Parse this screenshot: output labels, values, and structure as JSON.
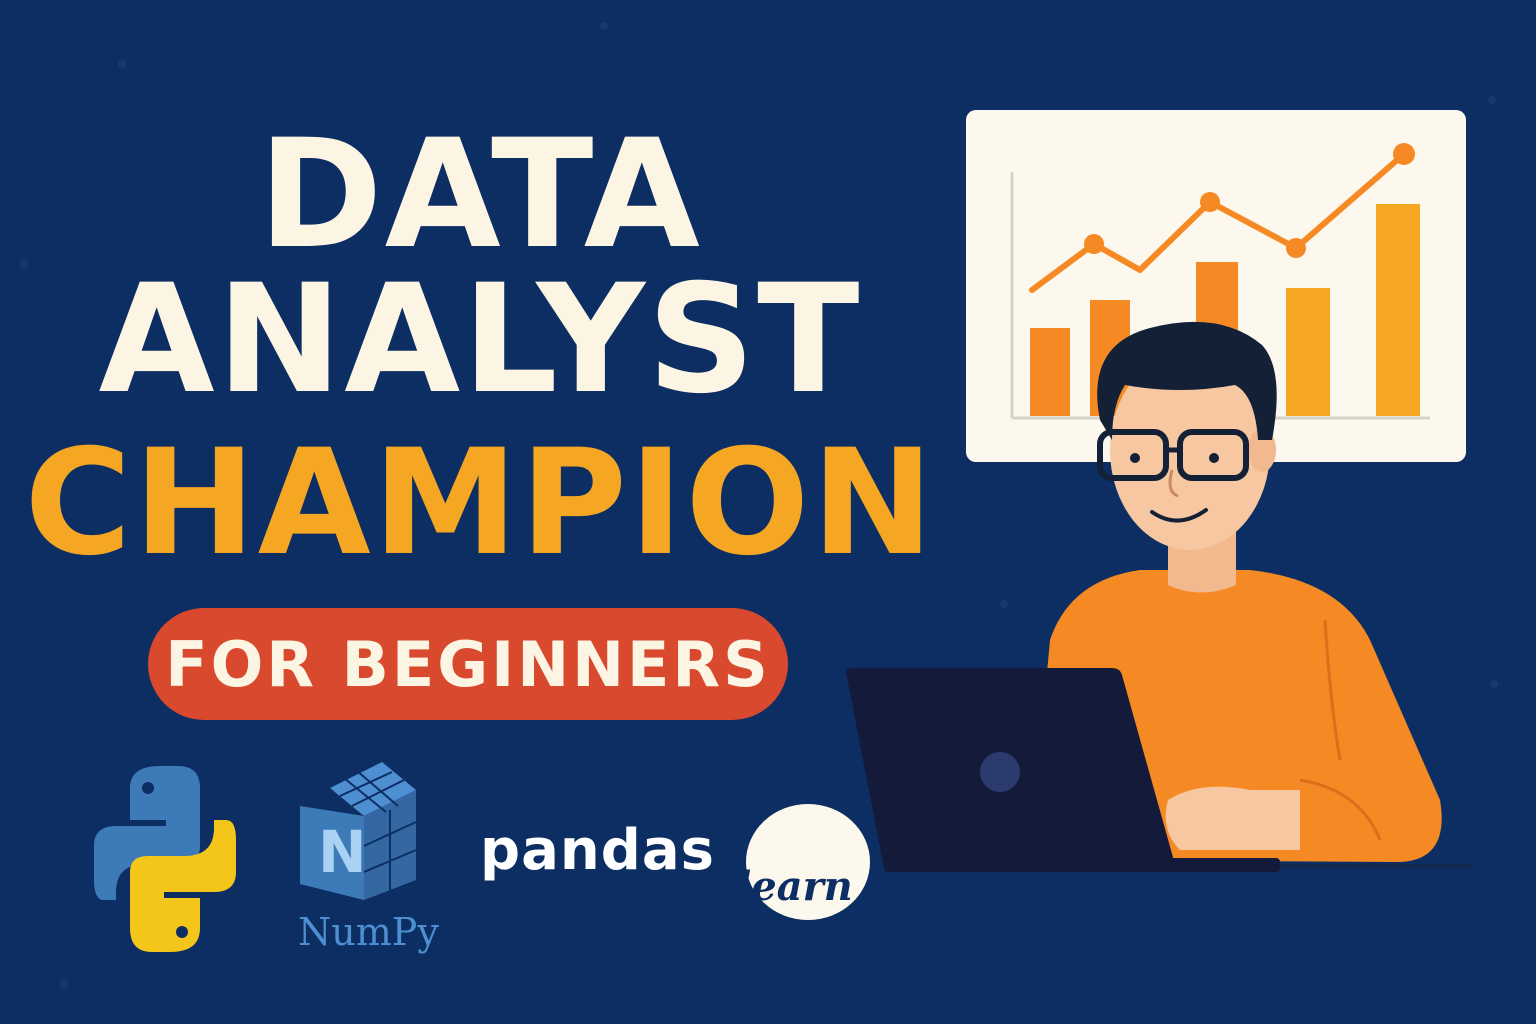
{
  "headline": {
    "line1": "DATA",
    "line2": "ANALYST",
    "line3": "CHAMPION"
  },
  "badge": {
    "label": "FOR BEGINNERS"
  },
  "logos": {
    "python": "python-logo",
    "numpy": "NumPy",
    "pandas": "pandas",
    "sklearn": "learn"
  },
  "colors": {
    "background": "#0c2e63",
    "accent": "#f5a623",
    "badge": "#d9492e",
    "shirt": "#f58a24",
    "text": "#fdf5e4"
  }
}
